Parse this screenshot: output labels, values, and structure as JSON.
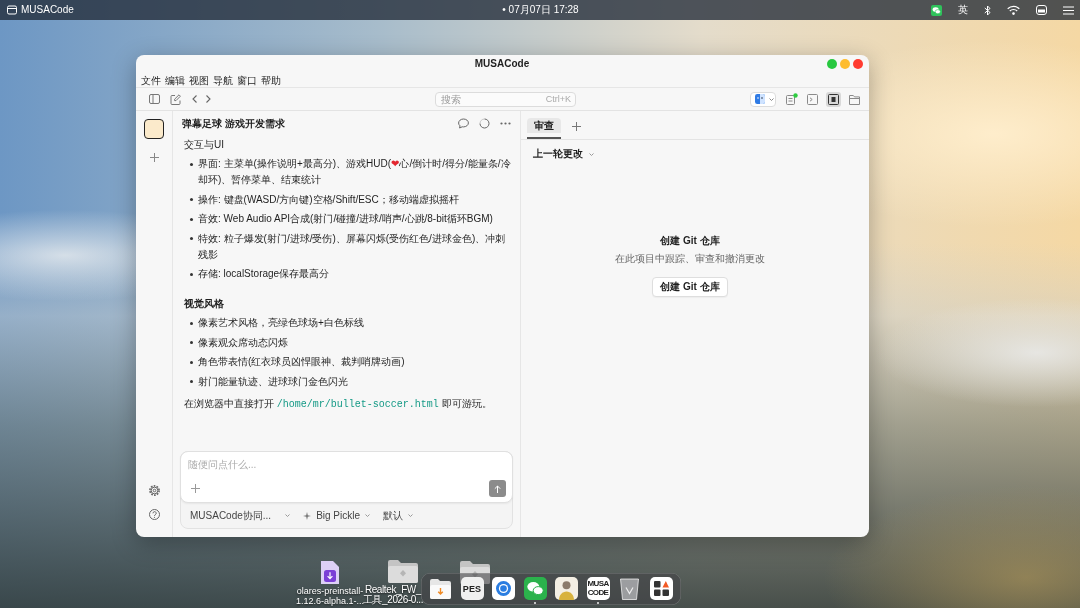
{
  "menubar": {
    "app_name": "MUSACode",
    "clock": "• 07月07日 17:28",
    "input_method": "英"
  },
  "window": {
    "title": "MUSACode",
    "menu": [
      "文件",
      "编辑",
      "视图",
      "导航",
      "窗口",
      "帮助"
    ],
    "toolbar": {
      "search": {
        "placeholder": "搜索",
        "shortcut": "Ctrl+K"
      },
      "toggles": [
        {
          "on": false
        },
        {
          "on": false
        },
        {
          "on": true
        },
        {
          "on": false
        }
      ]
    },
    "sidebar": {
      "projects": [
        {
          "selected": true
        }
      ]
    },
    "chat": {
      "title": "弹幕足球 游戏开发需求",
      "blocks": [
        {
          "kind": "paragraph",
          "text": "交互与UI"
        },
        {
          "kind": "list",
          "items": [
            [
              {
                "kind": "text",
                "text": "界面: 主菜单(操作说明+最高分)、游戏HUD("
              },
              {
                "kind": "emoji",
                "text": "❤"
              },
              {
                "kind": "text",
                "text": "心/倒计时/得分/能量条/冷却环)、暂停菜单、结束统计"
              }
            ],
            "操作: 键盘(WASD/方向键)空格/Shift/ESC；移动端虚拟摇杆",
            "音效: Web Audio API合成(射门/碰撞/进球/哨声/心跳/8-bit循环BGM)",
            "特效: 粒子爆发(射门/进球/受伤)、屏幕闪烁(受伤红色/进球金色)、冲刺残影",
            "存储: localStorage保存最高分"
          ]
        },
        {
          "kind": "heading",
          "text": "视觉风格"
        },
        {
          "kind": "list",
          "items": [
            "像素艺术风格，亮绿色球场+白色标线",
            "像素观众席动态闪烁",
            "角色带表情(红衣球员凶悍眼神、裁判哨牌动画)",
            "射门能量轨迹、进球球门金色闪光"
          ]
        },
        {
          "kind": "paragraph",
          "text": [
            {
              "kind": "text",
              "text": "在浏览器中直接打开 "
            },
            {
              "kind": "code",
              "text": "/home/mr/bullet-soccer.html"
            },
            {
              "kind": "text",
              "text": " 即可游玩。"
            }
          ]
        }
      ],
      "composer": {
        "placeholder": "随便问点什么..."
      },
      "selectors": [
        {
          "kind": "agent",
          "label": "MUSACode协同..."
        },
        {
          "kind": "model",
          "label": "Big Pickle"
        },
        {
          "kind": "mode",
          "label": "默认"
        }
      ]
    },
    "review": {
      "tabs": [
        {
          "label": "审查",
          "selected": true
        }
      ],
      "changes_filter": "上一轮更改",
      "empty_state": {
        "title": "创建 Git 仓库",
        "description": "在此项目中跟踪、审查和撤消更改",
        "button": "创建 Git 仓库"
      }
    }
  },
  "desktop_icons": [
    {
      "kind": "file",
      "label_lines": [
        "olares-preinstall-",
        "1.12.6-alpha.1-..."
      ]
    },
    {
      "kind": "folder",
      "label_lines": [
        "Realtek_FW_",
        "工具_2026-0..."
      ]
    },
    {
      "kind": "folder"
    }
  ],
  "dock": [
    {
      "kind": "folder",
      "running": false
    },
    {
      "kind": "pes",
      "label": "PES",
      "running": false
    },
    {
      "kind": "browser",
      "running": false
    },
    {
      "kind": "chat",
      "running": true
    },
    {
      "kind": "portrait",
      "running": false
    },
    {
      "kind": "musa",
      "label": [
        "MUSA",
        "CODE"
      ],
      "running": true
    },
    {
      "kind": "trash",
      "running": false
    },
    {
      "kind": "grid",
      "running": false
    }
  ]
}
